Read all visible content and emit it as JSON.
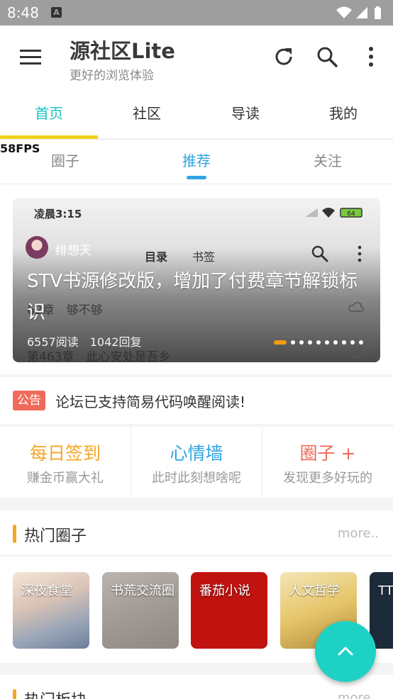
{
  "status_bar": {
    "time": "8:48",
    "notification_badge": "A",
    "icons": [
      "wifi-icon",
      "signal-icon",
      "battery-icon"
    ]
  },
  "header": {
    "title": "源社区Lite",
    "subtitle": "更好的浏览体验",
    "icons": [
      "menu-icon",
      "refresh-icon",
      "search-icon",
      "more-vert-icon"
    ]
  },
  "main_tabs": [
    {
      "label": "首页",
      "active": true
    },
    {
      "label": "社区",
      "active": false
    },
    {
      "label": "导读",
      "active": false
    },
    {
      "label": "我的",
      "active": false
    }
  ],
  "fps": "58FPS",
  "sub_tabs": [
    {
      "label": "圈子",
      "active": false
    },
    {
      "label": "推荐",
      "active": true
    },
    {
      "label": "关注",
      "active": false
    }
  ],
  "banner": {
    "inner_time": "凌晨3:15",
    "inner_battery": "64",
    "author": "绯想天",
    "inner_tab_catalog": "目录",
    "inner_tab_bookmark": "书签",
    "title": "STV书源修改版，增加了付费章节解锁标识",
    "under_line_1": "62章　够不够",
    "under_line_2": "第463章　此心安处是吾乡",
    "stats": "6557阅读　1042回复",
    "pager_count": 10,
    "pager_active_index": 0
  },
  "notice": {
    "badge": "公告",
    "text": "论坛已支持简易代码唤醒阅读!"
  },
  "quick_actions": [
    {
      "title": "每日签到",
      "subtitle": "赚金币赢大礼",
      "color": "#f5a623"
    },
    {
      "title": "心情墙",
      "subtitle": "此时此刻想啥呢",
      "color": "#2ea4e2"
    },
    {
      "title": "圈子 +",
      "subtitle": "发现更多好玩的",
      "color": "#ef6a5a"
    }
  ],
  "hot_circles": {
    "title": "热门圈子",
    "more": "more..",
    "items": [
      {
        "name": "深夜食堂"
      },
      {
        "name": "书荒交流圈"
      },
      {
        "name": "番茄小说"
      },
      {
        "name": "人文哲学"
      },
      {
        "name": "TT引"
      }
    ]
  },
  "hot_boards": {
    "title": "热门板块",
    "more": "more.."
  },
  "colors": {
    "accent": "#17c3c3",
    "tab_indicator": "#f0d21a",
    "sub_accent": "#2ea4e2",
    "fab": "#1ed1c5",
    "notice_badge": "#ef6a5a"
  }
}
